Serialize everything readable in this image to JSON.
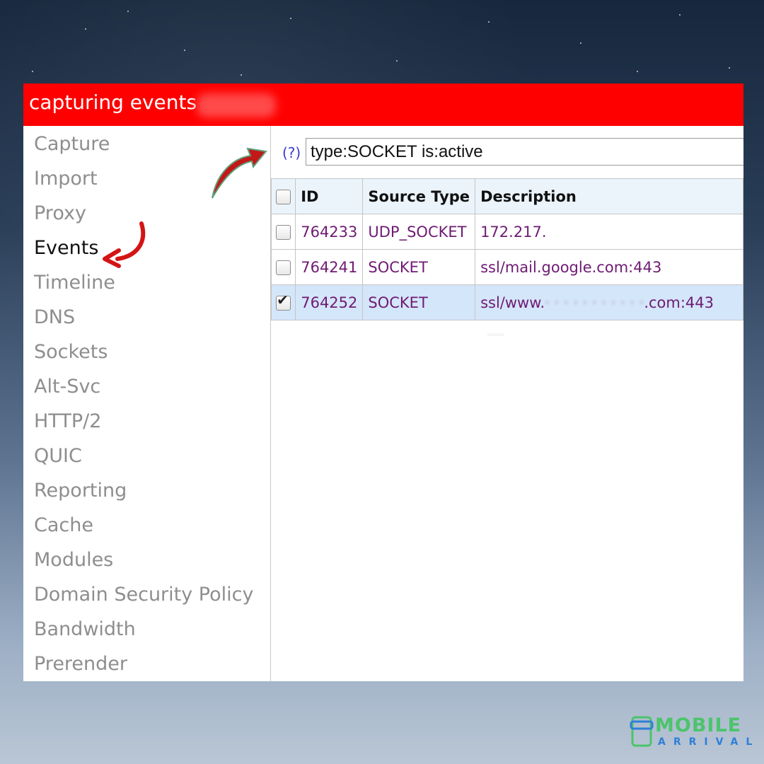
{
  "window": {
    "title": "capturing events"
  },
  "sidebar": {
    "items": [
      {
        "label": "Capture"
      },
      {
        "label": "Import"
      },
      {
        "label": "Proxy"
      },
      {
        "label": "Events",
        "active": true
      },
      {
        "label": "Timeline"
      },
      {
        "label": "DNS"
      },
      {
        "label": "Sockets"
      },
      {
        "label": "Alt-Svc"
      },
      {
        "label": "HTTP/2"
      },
      {
        "label": "QUIC"
      },
      {
        "label": "Reporting"
      },
      {
        "label": "Cache"
      },
      {
        "label": "Modules"
      },
      {
        "label": "Domain Security Policy"
      },
      {
        "label": "Bandwidth"
      },
      {
        "label": "Prerender"
      }
    ]
  },
  "filter": {
    "help_label": "(?)",
    "value": "type:SOCKET is:active"
  },
  "table": {
    "headers": {
      "id": "ID",
      "source_type": "Source Type",
      "description": "Description"
    },
    "rows": [
      {
        "checked": false,
        "id": "764233",
        "source_type": "UDP_SOCKET",
        "description_visible": "172.217.",
        "description_tail": ""
      },
      {
        "checked": false,
        "id": "764241",
        "source_type": "SOCKET",
        "description_visible": "ssl/mail.google.com:443",
        "description_tail": ""
      },
      {
        "checked": true,
        "id": "764252",
        "source_type": "SOCKET",
        "description_visible": "ssl/www.",
        "description_tail": ".com:443"
      }
    ]
  },
  "colors": {
    "title_bar": "#ff0000",
    "active_nav": "#111111",
    "inactive_nav": "#8e8e8e",
    "link_text": "#6e1b73",
    "selected_row": "#d4e6fa",
    "annotation_arrow": "#c21818"
  },
  "branding": {
    "logo_main": "MOBILE",
    "logo_sub": "ARRIVAL"
  }
}
